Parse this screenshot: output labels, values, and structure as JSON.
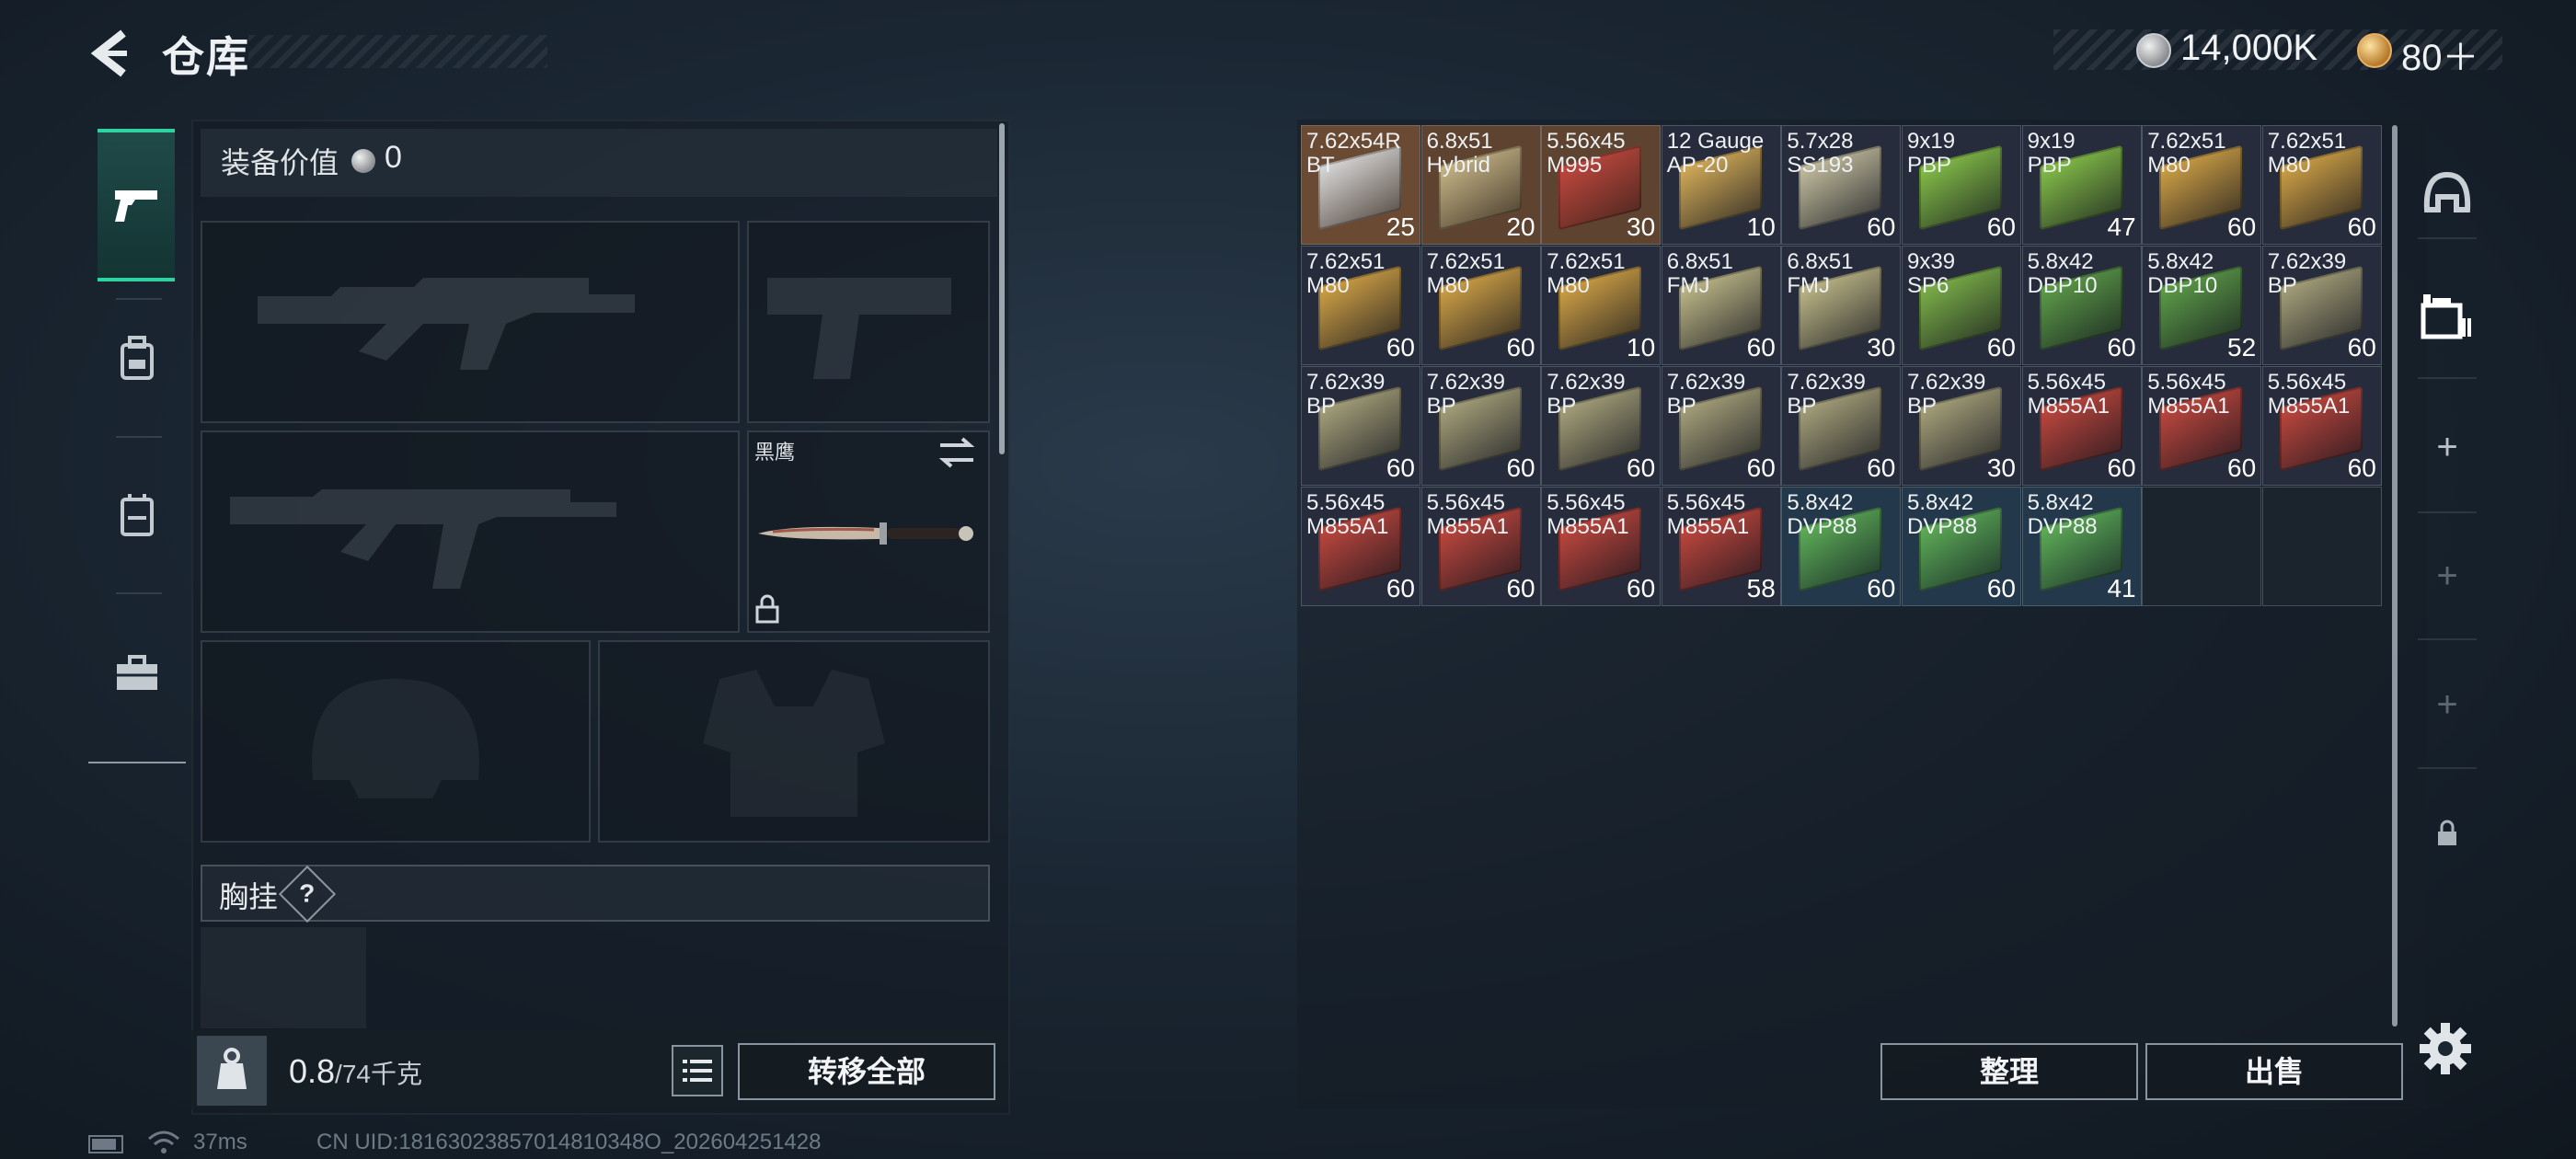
{
  "header": {
    "title": "仓库"
  },
  "currency": {
    "silver": "14,000K",
    "gold": "80＋"
  },
  "left_nav": [
    {
      "name": "weapons",
      "icon": "pistol-icon",
      "active": true
    },
    {
      "name": "backpack",
      "icon": "backpack-icon",
      "active": false
    },
    {
      "name": "armor",
      "icon": "vest-icon",
      "active": false
    },
    {
      "name": "toolbox",
      "icon": "toolbox-icon",
      "active": false
    }
  ],
  "equipment": {
    "value_label": "装备价值",
    "value": "0",
    "melee_name": "黑鹰",
    "rig_label": "胸挂",
    "rig_help": "?"
  },
  "footer_left": {
    "weight": "0.8",
    "weight_max": "/74千克",
    "transfer_label": "转移全部"
  },
  "status": {
    "ping": "37ms",
    "uid": "CN UID:18163023857014810348O_202604251428"
  },
  "warehouse": {
    "items": [
      {
        "line1": "7.62x54R",
        "line2": "BT",
        "qty": "25",
        "color": "#dcdcdc",
        "bg": "#6a4a32"
      },
      {
        "line1": "6.8x51",
        "line2": "Hybrid",
        "qty": "20",
        "color": "#c9b88a",
        "bg": "#5e4430"
      },
      {
        "line1": "5.56x45",
        "line2": "M995",
        "qty": "30",
        "color": "#c4483f",
        "bg": "#5e4430"
      },
      {
        "line1": "12 Gauge",
        "line2": "AP-20",
        "qty": "10",
        "color": "#d9b05a",
        "bg": "#262c3c"
      },
      {
        "line1": "5.7x28",
        "line2": "SS193",
        "qty": "60",
        "color": "#c8c2a2",
        "bg": "#262c3c"
      },
      {
        "line1": "9x19",
        "line2": "PBP",
        "qty": "60",
        "color": "#88c34a",
        "bg": "#262c3c"
      },
      {
        "line1": "9x19",
        "line2": "PBP",
        "qty": "47",
        "color": "#88c34a",
        "bg": "#262c3c"
      },
      {
        "line1": "7.62x51",
        "line2": "M80",
        "qty": "60",
        "color": "#d4a447",
        "bg": "#262c3c"
      },
      {
        "line1": "7.62x51",
        "line2": "M80",
        "qty": "60",
        "color": "#d4a447",
        "bg": "#262c3c"
      },
      {
        "line1": "7.62x51",
        "line2": "M80",
        "qty": "60",
        "color": "#d4a447",
        "bg": "#262c3c"
      },
      {
        "line1": "7.62x51",
        "line2": "M80",
        "qty": "60",
        "color": "#d4a447",
        "bg": "#262c3c"
      },
      {
        "line1": "7.62x51",
        "line2": "M80",
        "qty": "10",
        "color": "#d4a447",
        "bg": "#262c3c"
      },
      {
        "line1": "6.8x51",
        "line2": "FMJ",
        "qty": "60",
        "color": "#c2bb8a",
        "bg": "#262c3c"
      },
      {
        "line1": "6.8x51",
        "line2": "FMJ",
        "qty": "30",
        "color": "#c2bb8a",
        "bg": "#262c3c"
      },
      {
        "line1": "9x39",
        "line2": "SP6",
        "qty": "60",
        "color": "#7fb44a",
        "bg": "#262c3c"
      },
      {
        "line1": "5.8x42",
        "line2": "DBP10",
        "qty": "60",
        "color": "#5fa04a",
        "bg": "#262c3c"
      },
      {
        "line1": "5.8x42",
        "line2": "DBP10",
        "qty": "52",
        "color": "#5fa04a",
        "bg": "#262c3c"
      },
      {
        "line1": "7.62x39",
        "line2": "BP",
        "qty": "60",
        "color": "#a9a37c",
        "bg": "#262c3c"
      },
      {
        "line1": "7.62x39",
        "line2": "BP",
        "qty": "60",
        "color": "#a9a37c",
        "bg": "#262c3c"
      },
      {
        "line1": "7.62x39",
        "line2": "BP",
        "qty": "60",
        "color": "#a9a37c",
        "bg": "#262c3c"
      },
      {
        "line1": "7.62x39",
        "line2": "BP",
        "qty": "60",
        "color": "#a9a37c",
        "bg": "#262c3c"
      },
      {
        "line1": "7.62x39",
        "line2": "BP",
        "qty": "60",
        "color": "#a9a37c",
        "bg": "#262c3c"
      },
      {
        "line1": "7.62x39",
        "line2": "BP",
        "qty": "60",
        "color": "#a9a37c",
        "bg": "#262c3c"
      },
      {
        "line1": "7.62x39",
        "line2": "BP",
        "qty": "30",
        "color": "#a9a37c",
        "bg": "#262c3c"
      },
      {
        "line1": "5.56x45",
        "line2": "M855A1",
        "qty": "60",
        "color": "#c4483f",
        "bg": "#262c3c"
      },
      {
        "line1": "5.56x45",
        "line2": "M855A1",
        "qty": "60",
        "color": "#c4483f",
        "bg": "#262c3c"
      },
      {
        "line1": "5.56x45",
        "line2": "M855A1",
        "qty": "60",
        "color": "#c4483f",
        "bg": "#262c3c"
      },
      {
        "line1": "5.56x45",
        "line2": "M855A1",
        "qty": "60",
        "color": "#c4483f",
        "bg": "#262c3c"
      },
      {
        "line1": "5.56x45",
        "line2": "M855A1",
        "qty": "60",
        "color": "#c4483f",
        "bg": "#262c3c"
      },
      {
        "line1": "5.56x45",
        "line2": "M855A1",
        "qty": "60",
        "color": "#c4483f",
        "bg": "#262c3c"
      },
      {
        "line1": "5.56x45",
        "line2": "M855A1",
        "qty": "58",
        "color": "#c4483f",
        "bg": "#262c3c"
      },
      {
        "line1": "5.8x42",
        "line2": "DVP88",
        "qty": "60",
        "color": "#5fb058",
        "bg": "#23384a"
      },
      {
        "line1": "5.8x42",
        "line2": "DVP88",
        "qty": "60",
        "color": "#5fb058",
        "bg": "#23384a"
      },
      {
        "line1": "5.8x42",
        "line2": "DVP88",
        "qty": "41",
        "color": "#5fb058",
        "bg": "#23384a"
      }
    ],
    "sort_label": "整理",
    "sell_label": "出售"
  },
  "right_nav": [
    {
      "name": "helmet",
      "icon": "helmet-icon",
      "symbol": ""
    },
    {
      "name": "storage",
      "icon": "storage-icon",
      "symbol": ""
    },
    {
      "name": "expand-1",
      "icon": "plus-icon",
      "symbol": "+"
    },
    {
      "name": "expand-2",
      "icon": "plus-icon",
      "symbol": "+"
    },
    {
      "name": "expand-3",
      "icon": "plus-icon",
      "symbol": "+"
    },
    {
      "name": "locked",
      "icon": "lock-icon",
      "symbol": ""
    }
  ]
}
